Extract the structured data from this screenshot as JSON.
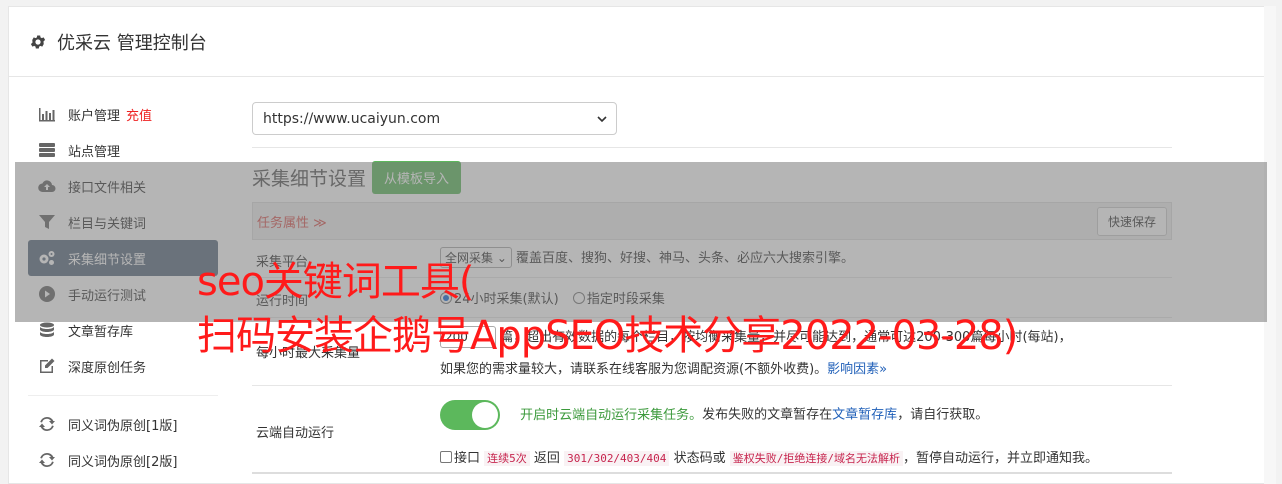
{
  "header": {
    "title": "优采云 管理控制台",
    "icon": "gear-icon"
  },
  "sidebar": {
    "items": [
      {
        "label": "账户管理",
        "extra": "充值",
        "icon": "bar-chart-icon"
      },
      {
        "label": "站点管理",
        "icon": "server-icon"
      },
      {
        "label": "接口文件相关",
        "icon": "cloud-upload-icon"
      },
      {
        "label": "栏目与关键词",
        "icon": "filter-icon"
      },
      {
        "label": "采集细节设置",
        "icon": "cogs-icon",
        "active": true
      },
      {
        "label": "手动运行测试",
        "icon": "play-icon"
      },
      {
        "label": "文章暂存库",
        "icon": "database-icon"
      },
      {
        "label": "深度原创任务",
        "icon": "edit-icon"
      },
      {
        "label": "同义词伪原创[1版]",
        "icon": "refresh-icon"
      },
      {
        "label": "同义词伪原创[2版]",
        "icon": "refresh-icon"
      }
    ]
  },
  "site_select": {
    "value": "https://www.ucaiyun.com"
  },
  "section": {
    "title": "采集细节设置",
    "import_button": "从模板导入"
  },
  "table": {
    "attr_label": "任务属性 ≫",
    "quick_save": "快速保存",
    "rows": {
      "engine": {
        "label": "采集平台",
        "select_value": "全网采集",
        "desc": "覆盖百度、搜狗、好搜、神马、头条、必应六大搜索引擎。"
      },
      "runtime": {
        "label": "运行时间",
        "option1": "24小时采集(默认)",
        "option2": "指定时段采集"
      },
      "max": {
        "label": "每小时最大采集量",
        "value": "200",
        "line1_a": "篇，超出有效数据的每个栏目，按均衡采集量，并尽可能达到，通常可达200-300篇每小时(每站)，",
        "line2_a": "如果您的需求量较大，请联系在线客服为您调配资源(不额外收费)。",
        "line2_link": "影响因素»"
      },
      "cloud": {
        "label": "云端自动运行",
        "line1_green": "开启时云端自动运行采集任务。",
        "line1_a": "发布失败的文章暂存在",
        "line1_link": "文章暂存库",
        "line1_b": "，请自行获取。",
        "line2_a": "接口",
        "line2_code1": "连续5次",
        "line2_b": "返回",
        "line2_code2": "301/302/403/404",
        "line2_c": "状态码或",
        "line2_code3": "鉴权失败/拒绝连接/域名无法解析",
        "line2_d": "，暂停自动运行，并立即通知我。"
      }
    }
  },
  "watermark": {
    "line1": "seo关键词工具(",
    "line2": "扫码安装企鹅号AppSEO技术分享2022-03-28)"
  }
}
